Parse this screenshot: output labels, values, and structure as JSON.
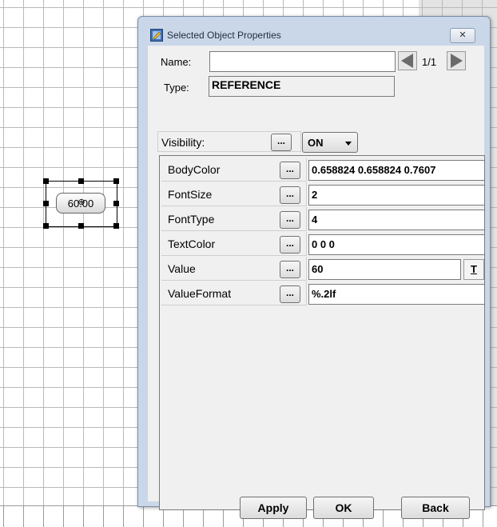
{
  "canvas": {
    "widget_value": "60.00"
  },
  "dialog": {
    "title": "Selected Object Properties",
    "name_label": "Name:",
    "name_value": "",
    "page_indicator": "1/1",
    "type_label": "Type:",
    "type_value": "REFERENCE",
    "visibility_label": "Visibility:",
    "visibility_value": "ON",
    "dots_label": "...",
    "properties": [
      {
        "name": "BodyColor",
        "value": "0.658824 0.658824 0.7607"
      },
      {
        "name": "FontSize",
        "value": "2"
      },
      {
        "name": "FontType",
        "value": "4"
      },
      {
        "name": "TextColor",
        "value": "0 0 0"
      },
      {
        "name": "Value",
        "value": "60"
      },
      {
        "name": "ValueFormat",
        "value": "%.2lf"
      }
    ],
    "t_button": "T",
    "apply_label": "Apply",
    "ok_label": "OK",
    "back_label": "Back"
  }
}
